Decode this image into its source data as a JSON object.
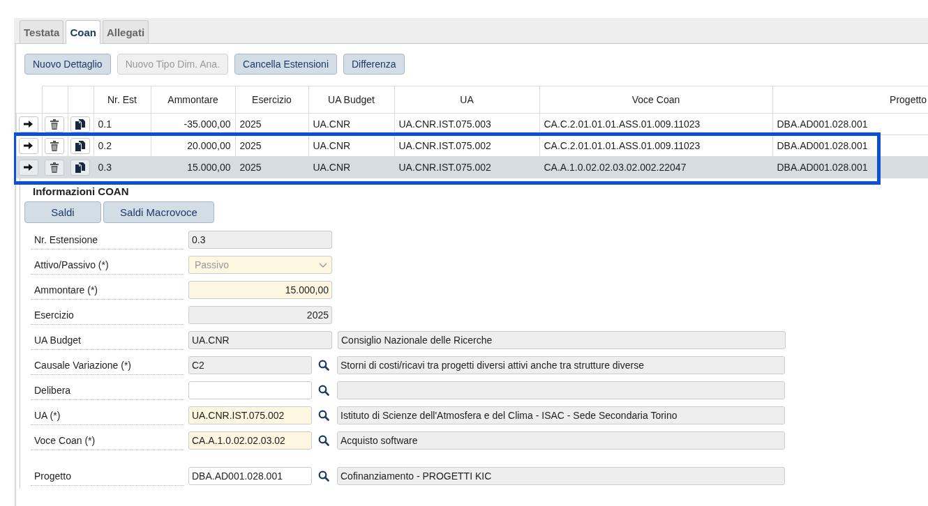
{
  "tabs": [
    {
      "label": "Testata",
      "selected": false
    },
    {
      "label": "Coan",
      "selected": true
    },
    {
      "label": "Allegati",
      "selected": false
    }
  ],
  "toolbar": [
    {
      "label": "Nuovo Dettaglio",
      "disabled": false
    },
    {
      "label": "Nuovo Tipo Dim. Ana.",
      "disabled": true
    },
    {
      "label": "Cancella Estensioni",
      "disabled": false
    },
    {
      "label": "Differenza",
      "disabled": false
    }
  ],
  "table": {
    "columns": [
      "Nr. Est",
      "Ammontare",
      "Esercizio",
      "UA Budget",
      "UA",
      "Voce Coan",
      "Progetto"
    ],
    "rows": [
      {
        "selected": false,
        "highlighted": false,
        "cells": [
          "0.1",
          "-35.000,00",
          "2025",
          "UA.CNR",
          "UA.CNR.IST.075.003",
          "CA.C.2.01.01.01.ASS.01.009.11023",
          "DBA.AD001.028.001"
        ]
      },
      {
        "selected": false,
        "highlighted": true,
        "cells": [
          "0.2",
          "20.000,00",
          "2025",
          "UA.CNR",
          "UA.CNR.IST.075.002",
          "CA.C.2.01.01.01.ASS.01.009.11023",
          "DBA.AD001.028.001"
        ]
      },
      {
        "selected": true,
        "highlighted": true,
        "cells": [
          "0.3",
          "15.000,00",
          "2025",
          "UA.CNR",
          "UA.CNR.IST.075.002",
          "CA.A.1.0.02.02.03.02.002.22047",
          "DBA.AD001.028.001"
        ]
      }
    ]
  },
  "details": {
    "title": "Informazioni COAN",
    "buttons": [
      "Saldi",
      "Saldi Macrovoce"
    ],
    "fields": [
      {
        "kind": "text",
        "label": "Nr. Estensione",
        "value": "0.3",
        "readonly": true
      },
      {
        "kind": "select",
        "label": "Attivo/Passivo (*)",
        "value": "Passivo",
        "required": true,
        "disabled": true
      },
      {
        "kind": "number",
        "label": "Ammontare (*)",
        "value": "15.000,00",
        "readonly": false,
        "required": true
      },
      {
        "kind": "number",
        "label": "Esercizio",
        "value": "2025",
        "readonly": true
      },
      {
        "kind": "text",
        "label": "UA Budget",
        "value": "UA.CNR",
        "readonly": true,
        "description": "Consiglio Nazionale delle Ricerche"
      },
      {
        "kind": "lookup",
        "label": "Causale Variazione (*)",
        "value": "C2",
        "readonly": true,
        "description": "Storni di costi/ricavi tra progetti diversi attivi anche tra strutture diverse"
      },
      {
        "kind": "lookup",
        "label": "Delibera",
        "readonly": false,
        "required": false
      },
      {
        "kind": "lookup",
        "label": "UA (*)",
        "value": "UA.CNR.IST.075.002",
        "readonly": false,
        "required": true,
        "description": "Istituto di Scienze dell'Atmosfera e del Clima - ISAC - Sede Secondaria Torino"
      },
      {
        "kind": "lookup",
        "label": "Voce Coan (*)",
        "value": "CA.A.1.0.02.02.03.02",
        "readonly": false,
        "required": true,
        "description": "Acquisto software"
      },
      {
        "kind": "lookup",
        "label": "Progetto",
        "value": "DBA.AD001.028.001",
        "readonly": false,
        "required": false,
        "group_break": true,
        "description": "Cofinanziamento - PROGETTI KIC"
      }
    ]
  }
}
